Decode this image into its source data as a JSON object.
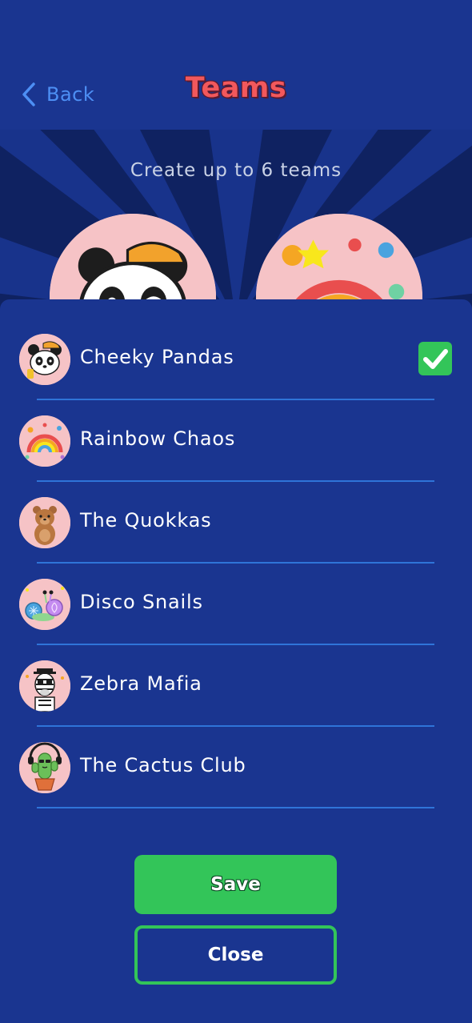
{
  "header": {
    "back_label": "Back",
    "title": "Teams"
  },
  "hero": {
    "subtitle": "Create up to 6 teams",
    "avatars": [
      {
        "icon": "panda-icon"
      },
      {
        "icon": "rainbow-chaos-icon"
      }
    ]
  },
  "teams": [
    {
      "name": "Cheeky Pandas",
      "icon": "panda-icon",
      "selected": true
    },
    {
      "name": "Rainbow Chaos",
      "icon": "rainbow-chaos-icon",
      "selected": false
    },
    {
      "name": "The Quokkas",
      "icon": "quokka-icon",
      "selected": false
    },
    {
      "name": "Disco Snails",
      "icon": "disco-snails-icon",
      "selected": false
    },
    {
      "name": "Zebra Mafia",
      "icon": "zebra-icon",
      "selected": false
    },
    {
      "name": "The Cactus Club",
      "icon": "cactus-icon",
      "selected": false
    }
  ],
  "buttons": {
    "save_label": "Save",
    "close_label": "Close"
  },
  "colors": {
    "background": "#1a3590",
    "title": "#f2585c",
    "back_link": "#4d8ff4",
    "accent_green": "#33c559",
    "divider": "#2f74d8",
    "avatar_bg": "#f6c3c6"
  }
}
